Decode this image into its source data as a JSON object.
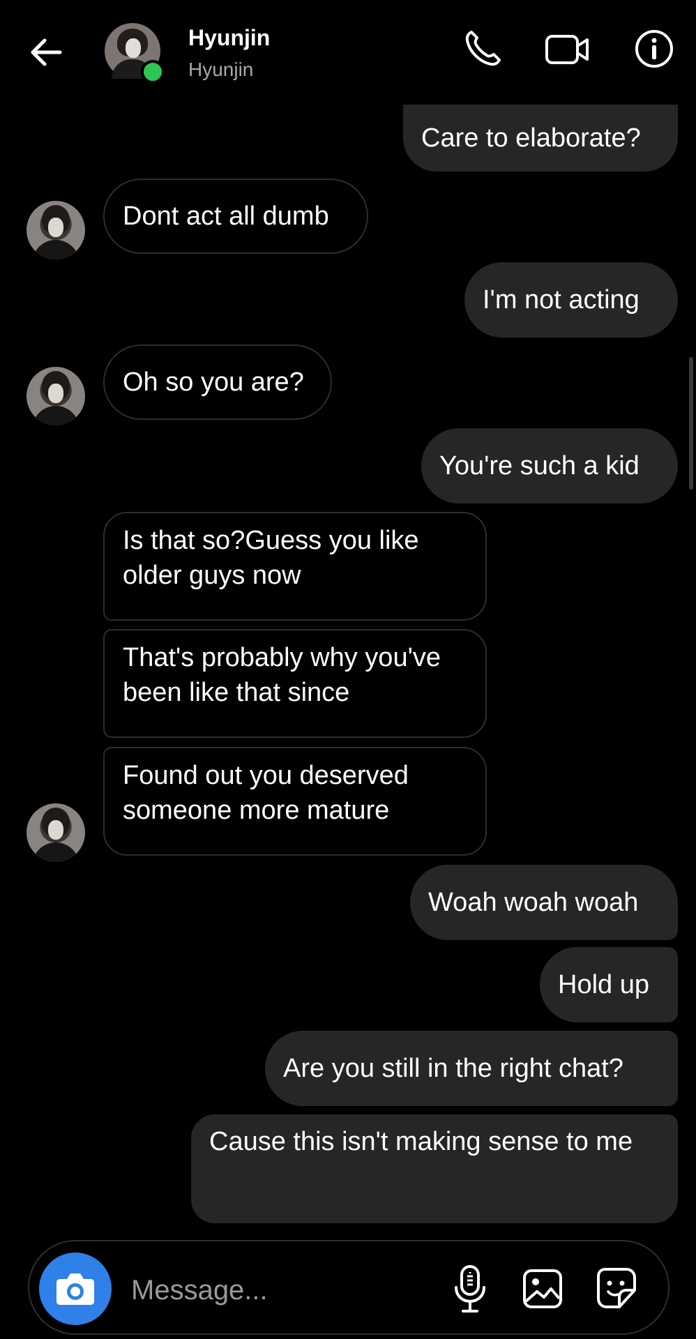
{
  "header": {
    "name": "Hyunjin",
    "username": "Hyunjin",
    "online_color": "#2fc553",
    "icons": [
      "back-arrow-icon",
      "phone-icon",
      "video-camera-icon",
      "info-icon"
    ]
  },
  "messages": [
    {
      "from": "me",
      "text": "Care to elaborate?"
    },
    {
      "from": "them",
      "text": "Dont act all dumb"
    },
    {
      "from": "me",
      "text": "I'm not acting"
    },
    {
      "from": "them",
      "text": "Oh so you are?"
    },
    {
      "from": "me",
      "text": "You're such a kid"
    },
    {
      "from": "them",
      "text": "Is that so?Guess you like older guys now"
    },
    {
      "from": "them",
      "text": "That's probably why you've been like that since"
    },
    {
      "from": "them",
      "text": "Found out you deserved someone more mature"
    },
    {
      "from": "me",
      "text": "Woah woah woah"
    },
    {
      "from": "me",
      "text": "Hold up"
    },
    {
      "from": "me",
      "text": "Are you still in the right chat?"
    },
    {
      "from": "me",
      "text": "Cause this isn't making sense to me"
    }
  ],
  "composer": {
    "placeholder": "Message...",
    "accent": "#2f80e8",
    "icons": [
      "camera-icon",
      "microphone-icon",
      "gallery-icon",
      "sticker-icon"
    ]
  },
  "colors": {
    "background": "#000000",
    "sent_bubble": "#262626",
    "received_border": "#2e2e2e"
  }
}
